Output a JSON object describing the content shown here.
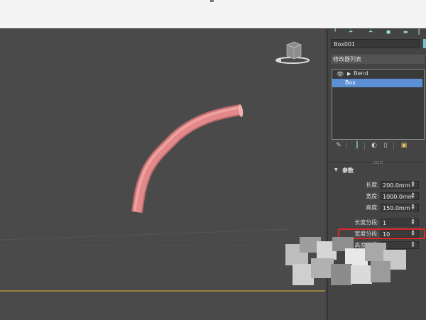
{
  "viewport": {
    "view_cube_label": "",
    "bend_object_color": "#e3898a",
    "grid_line_color": "#c7a136"
  },
  "panel": {
    "object_name": "Box001",
    "modifier_list_label": "修改器列表",
    "stack_items": [
      {
        "label": "Bend",
        "selected": false
      },
      {
        "label": "Box",
        "selected": true
      }
    ],
    "toolbar_icons": [
      "pin-stack-icon",
      "show-end-result-icon",
      "make-unique-icon",
      "remove-modifier-icon",
      "configure-modifier-sets-icon"
    ],
    "rollout_title": "参数",
    "params": [
      {
        "label": "长度:",
        "value": "200.0mm"
      },
      {
        "label": "宽度:",
        "value": "1000.0mm"
      },
      {
        "label": "高度:",
        "value": "150.0mm"
      },
      {
        "label": "长度分段:",
        "value": "1"
      },
      {
        "label": "宽度分段:",
        "value": "10"
      },
      {
        "label": "高度分段:",
        "value": "1"
      }
    ]
  },
  "annotation": {
    "highlight_color": "#e02828",
    "highlighted_param": "宽度分段:"
  }
}
